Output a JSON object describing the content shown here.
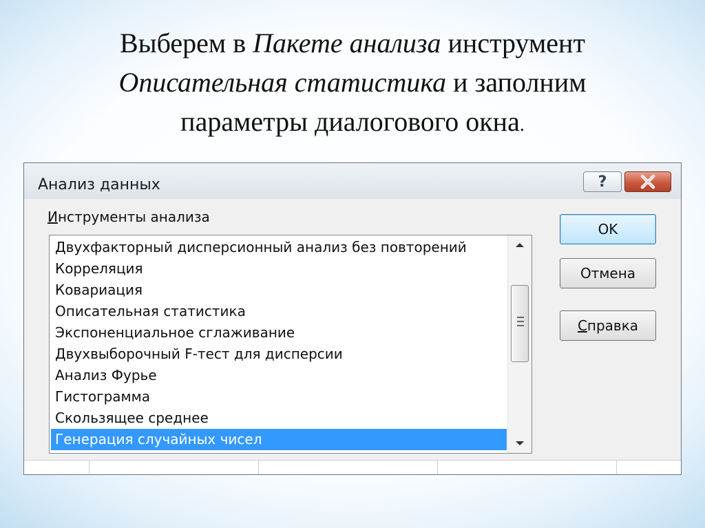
{
  "slide": {
    "title_part1": "Выберем в ",
    "title_italic1": "Пакете анализа",
    "title_part2": " инструмент",
    "title_italic2": "Описательная статистика",
    "title_part3": " и заполним",
    "title_line3": "параметры диалогового окна",
    "title_end": "."
  },
  "dialog": {
    "title": "Анализ данных",
    "help_label": "?",
    "close_icon": "close-x-icon",
    "section_label_mnemonic": "И",
    "section_label_rest": "нструменты анализа",
    "list_items": [
      "Двухфакторный дисперсионный анализ без повторений",
      "Корреляция",
      "Ковариация",
      "Описательная статистика",
      "Экспоненциальное сглаживание",
      "Двухвыборочный F-тест для дисперсии",
      "Анализ Фурье",
      "Гистограмма",
      "Скользящее среднее",
      "Генерация случайных чисел"
    ],
    "selected_item": "Генерация случайных чисел",
    "ok_label": "OK",
    "cancel_label": "Отмена",
    "help_button_mnemonic": "С",
    "help_button_rest": "правка"
  },
  "colors": {
    "selection": "#3399ff",
    "close_button": "#c85a3f"
  }
}
